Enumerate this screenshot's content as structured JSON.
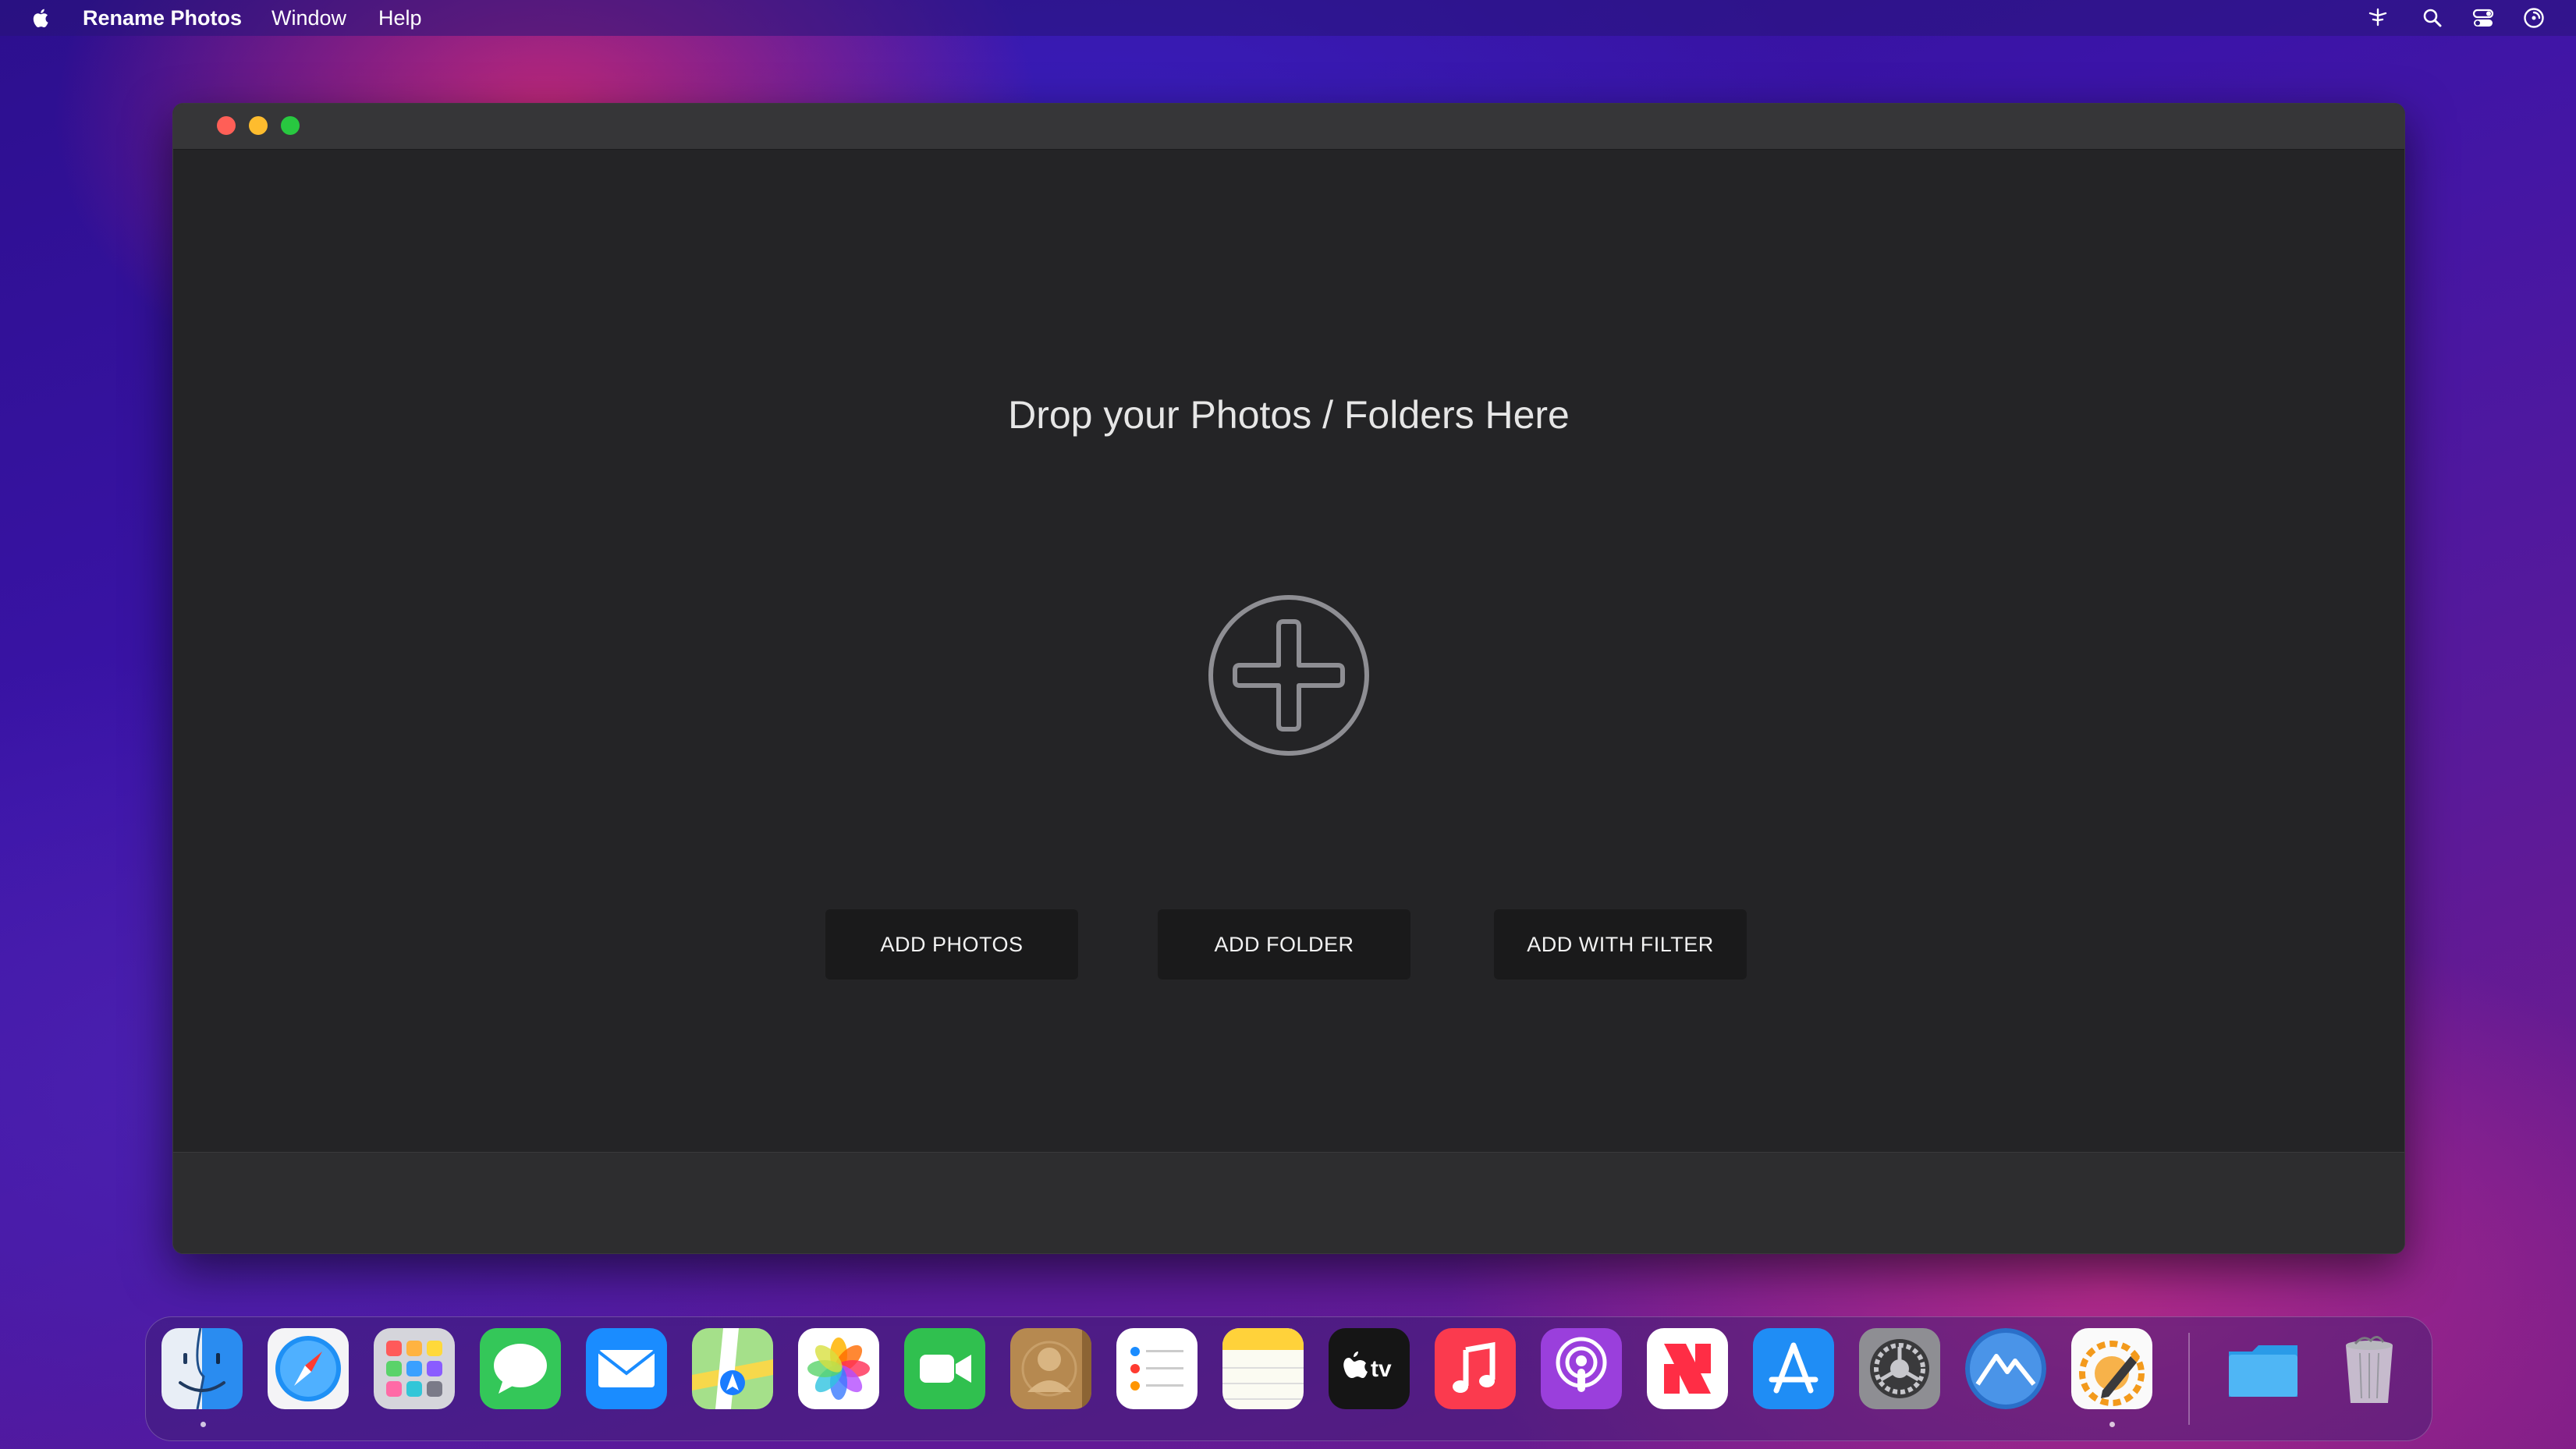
{
  "menubar": {
    "app_name": "Rename Photos",
    "menus": [
      "Window",
      "Help"
    ],
    "status_icons": [
      "wifi-icon",
      "search-icon",
      "control-center-icon",
      "siri-icon"
    ]
  },
  "window": {
    "drop_title": "Drop your Photos / Folders Here",
    "buttons": {
      "add_photos": "ADD PHOTOS",
      "add_folder": "ADD FOLDER",
      "add_with_filter": "ADD WITH FILTER"
    }
  },
  "dock": {
    "apps": [
      "finder-icon",
      "safari-icon",
      "launchpad-icon",
      "messages-icon",
      "mail-icon",
      "maps-icon",
      "photos-icon",
      "facetime-icon",
      "contacts-icon",
      "reminders-icon",
      "notes-icon",
      "tv-icon",
      "music-icon",
      "podcasts-icon",
      "news-icon",
      "app-store-icon",
      "system-preferences-icon",
      "mountain-app-icon",
      "rename-photos-icon",
      "downloads-folder-icon",
      "trash-icon"
    ],
    "tv_label": "tv"
  },
  "colors": {
    "close": "#ff5f57",
    "minimize": "#febc2e",
    "maximize": "#28c840",
    "window_bg": "#242426",
    "button_bg": "#1a1a1b"
  }
}
